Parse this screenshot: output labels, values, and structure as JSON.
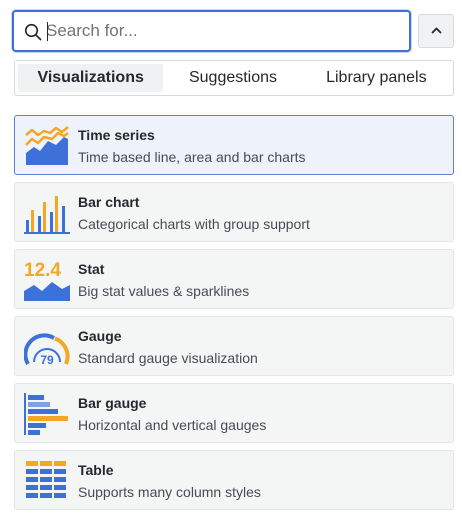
{
  "search": {
    "placeholder": "Search for...",
    "value": ""
  },
  "tabs": [
    {
      "label": "Visualizations",
      "active": true
    },
    {
      "label": "Suggestions",
      "active": false
    },
    {
      "label": "Library panels",
      "active": false
    }
  ],
  "visualizations": [
    {
      "title": "Time series",
      "description": "Time based line, area and bar charts",
      "icon": "time-series-icon",
      "selected": true
    },
    {
      "title": "Bar chart",
      "description": "Categorical charts with group support",
      "icon": "bar-chart-icon"
    },
    {
      "title": "Stat",
      "description": "Big stat values & sparklines",
      "icon": "stat-icon",
      "icon_text": "12.4"
    },
    {
      "title": "Gauge",
      "description": "Standard gauge visualization",
      "icon": "gauge-icon",
      "icon_text": "79"
    },
    {
      "title": "Bar gauge",
      "description": "Horizontal and vertical gauges",
      "icon": "bar-gauge-icon"
    },
    {
      "title": "Table",
      "description": "Supports many column styles",
      "icon": "table-icon"
    }
  ],
  "colors": {
    "accent": "#3d71d9",
    "blue": "#3d71d9",
    "orange": "#f5a623",
    "selected_bg": "#eef2fa"
  }
}
